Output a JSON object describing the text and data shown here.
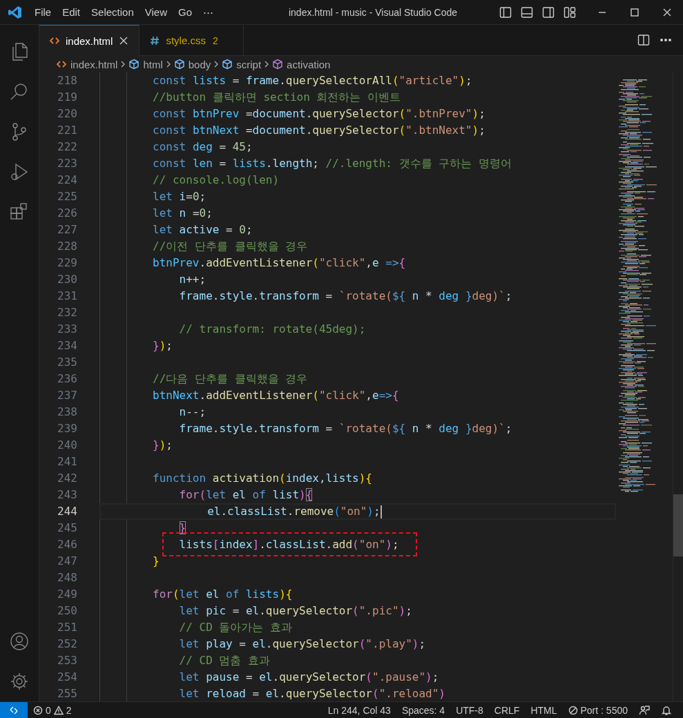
{
  "window": {
    "title": "index.html - music - Visual Studio Code"
  },
  "menu": [
    "File",
    "Edit",
    "Selection",
    "View",
    "Go",
    "⋯"
  ],
  "tabs": [
    {
      "label": "index.html",
      "kind": "html",
      "selected": true
    },
    {
      "label": "style.css",
      "kind": "css",
      "selected": false,
      "problems": "2"
    }
  ],
  "breadcrumb": [
    {
      "label": "index.html",
      "kind": "file"
    },
    {
      "label": "html",
      "kind": "element"
    },
    {
      "label": "body",
      "kind": "element"
    },
    {
      "label": "script",
      "kind": "element"
    },
    {
      "label": "activation",
      "kind": "method"
    }
  ],
  "editor": {
    "lines": [
      {
        "number": "218",
        "current": false,
        "boxed": false,
        "tokens": [
          {
            "kind": "keyword",
            "text": "        const"
          },
          {
            "kind": "constant",
            "text": " lists"
          },
          {
            "kind": "punct",
            "text": " = "
          },
          {
            "kind": "variable",
            "text": "frame"
          },
          {
            "kind": "punct",
            "text": "."
          },
          {
            "kind": "function",
            "text": "querySelectorAll"
          },
          {
            "kind": "bracket1",
            "text": "("
          },
          {
            "kind": "string",
            "text": "\"article\""
          },
          {
            "kind": "bracket1",
            "text": ")"
          },
          {
            "kind": "punct",
            "text": ";"
          }
        ]
      },
      {
        "number": "219",
        "current": false,
        "boxed": false,
        "tokens": [
          {
            "kind": "comment",
            "text": "        //button 클릭하면 section 회전하는 이벤트"
          }
        ]
      },
      {
        "number": "220",
        "current": false,
        "boxed": false,
        "tokens": [
          {
            "kind": "keyword",
            "text": "        const"
          },
          {
            "kind": "constant",
            "text": " btnPrev"
          },
          {
            "kind": "punct",
            "text": " ="
          },
          {
            "kind": "variable",
            "text": "document"
          },
          {
            "kind": "punct",
            "text": "."
          },
          {
            "kind": "function",
            "text": "querySelector"
          },
          {
            "kind": "bracket1",
            "text": "("
          },
          {
            "kind": "string",
            "text": "\".btnPrev\""
          },
          {
            "kind": "bracket1",
            "text": ")"
          },
          {
            "kind": "punct",
            "text": ";"
          }
        ]
      },
      {
        "number": "221",
        "current": false,
        "boxed": false,
        "tokens": [
          {
            "kind": "keyword",
            "text": "        const"
          },
          {
            "kind": "constant",
            "text": " btnNext"
          },
          {
            "kind": "punct",
            "text": " ="
          },
          {
            "kind": "variable",
            "text": "document"
          },
          {
            "kind": "punct",
            "text": "."
          },
          {
            "kind": "function",
            "text": "querySelector"
          },
          {
            "kind": "bracket1",
            "text": "("
          },
          {
            "kind": "string",
            "text": "\".btnNext\""
          },
          {
            "kind": "bracket1",
            "text": ")"
          },
          {
            "kind": "punct",
            "text": ";"
          }
        ]
      },
      {
        "number": "222",
        "current": false,
        "boxed": false,
        "tokens": [
          {
            "kind": "keyword",
            "text": "        const"
          },
          {
            "kind": "constant",
            "text": " deg"
          },
          {
            "kind": "punct",
            "text": " = "
          },
          {
            "kind": "number",
            "text": "45"
          },
          {
            "kind": "punct",
            "text": ";"
          }
        ]
      },
      {
        "number": "223",
        "current": false,
        "boxed": false,
        "tokens": [
          {
            "kind": "keyword",
            "text": "        const"
          },
          {
            "kind": "constant",
            "text": " len"
          },
          {
            "kind": "punct",
            "text": " = "
          },
          {
            "kind": "constant",
            "text": "lists"
          },
          {
            "kind": "punct",
            "text": "."
          },
          {
            "kind": "variable",
            "text": "length"
          },
          {
            "kind": "punct",
            "text": "; "
          },
          {
            "kind": "comment",
            "text": "//.length: 갯수를 구하는 명령어"
          }
        ]
      },
      {
        "number": "224",
        "current": false,
        "boxed": false,
        "tokens": [
          {
            "kind": "comment",
            "text": "        // console.log(len)"
          }
        ]
      },
      {
        "number": "225",
        "current": false,
        "boxed": false,
        "tokens": [
          {
            "kind": "keyword",
            "text": "        let"
          },
          {
            "kind": "variable",
            "text": " i"
          },
          {
            "kind": "punct",
            "text": "="
          },
          {
            "kind": "number",
            "text": "0"
          },
          {
            "kind": "punct",
            "text": ";"
          }
        ]
      },
      {
        "number": "226",
        "current": false,
        "boxed": false,
        "tokens": [
          {
            "kind": "keyword",
            "text": "        let"
          },
          {
            "kind": "variable",
            "text": " n"
          },
          {
            "kind": "punct",
            "text": " ="
          },
          {
            "kind": "number",
            "text": "0"
          },
          {
            "kind": "punct",
            "text": ";"
          }
        ]
      },
      {
        "number": "227",
        "current": false,
        "boxed": false,
        "tokens": [
          {
            "kind": "keyword",
            "text": "        let"
          },
          {
            "kind": "variable",
            "text": " active"
          },
          {
            "kind": "punct",
            "text": " = "
          },
          {
            "kind": "number",
            "text": "0"
          },
          {
            "kind": "punct",
            "text": ";"
          }
        ]
      },
      {
        "number": "228",
        "current": false,
        "boxed": false,
        "tokens": [
          {
            "kind": "comment",
            "text": "        //이전 단추를 클릭했을 경우"
          }
        ]
      },
      {
        "number": "229",
        "current": false,
        "boxed": false,
        "tokens": [
          {
            "kind": "constant",
            "text": "        btnPrev"
          },
          {
            "kind": "punct",
            "text": "."
          },
          {
            "kind": "function",
            "text": "addEventListener"
          },
          {
            "kind": "bracket1",
            "text": "("
          },
          {
            "kind": "string",
            "text": "\"click\""
          },
          {
            "kind": "punct",
            "text": ","
          },
          {
            "kind": "variable",
            "text": "e"
          },
          {
            "kind": "keyword",
            "text": " =>"
          },
          {
            "kind": "bracket2",
            "text": "{"
          }
        ]
      },
      {
        "number": "230",
        "current": false,
        "boxed": false,
        "tokens": [
          {
            "kind": "variable",
            "text": "            n"
          },
          {
            "kind": "punct",
            "text": "++;"
          }
        ]
      },
      {
        "number": "231",
        "current": false,
        "boxed": false,
        "tokens": [
          {
            "kind": "variable",
            "text": "            frame"
          },
          {
            "kind": "punct",
            "text": "."
          },
          {
            "kind": "variable",
            "text": "style"
          },
          {
            "kind": "punct",
            "text": "."
          },
          {
            "kind": "variable",
            "text": "transform"
          },
          {
            "kind": "punct",
            "text": " = "
          },
          {
            "kind": "string",
            "text": "`rotate("
          },
          {
            "kind": "interp",
            "text": "${"
          },
          {
            "kind": "variable",
            "text": " n"
          },
          {
            "kind": "punct",
            "text": " * "
          },
          {
            "kind": "constant",
            "text": "deg"
          },
          {
            "kind": "interp",
            "text": " }"
          },
          {
            "kind": "string",
            "text": "deg)`"
          },
          {
            "kind": "punct",
            "text": ";"
          }
        ]
      },
      {
        "number": "232",
        "current": false,
        "boxed": false
      },
      {
        "number": "233",
        "current": false,
        "boxed": false,
        "tokens": [
          {
            "kind": "comment",
            "text": "            // transform: rotate(45deg);"
          }
        ]
      },
      {
        "number": "234",
        "current": false,
        "boxed": false,
        "tokens": [
          {
            "kind": "bracket2",
            "text": "        }"
          },
          {
            "kind": "bracket1",
            "text": ")"
          },
          {
            "kind": "punct",
            "text": ";"
          }
        ]
      },
      {
        "number": "235",
        "current": false,
        "boxed": false
      },
      {
        "number": "236",
        "current": false,
        "boxed": false,
        "tokens": [
          {
            "kind": "comment",
            "text": "        //다음 단추를 클릭했을 경우"
          }
        ]
      },
      {
        "number": "237",
        "current": false,
        "boxed": false,
        "tokens": [
          {
            "kind": "constant",
            "text": "        btnNext"
          },
          {
            "kind": "punct",
            "text": "."
          },
          {
            "kind": "function",
            "text": "addEventListener"
          },
          {
            "kind": "bracket1",
            "text": "("
          },
          {
            "kind": "string",
            "text": "\"click\""
          },
          {
            "kind": "punct",
            "text": ","
          },
          {
            "kind": "variable",
            "text": "e"
          },
          {
            "kind": "keyword",
            "text": "=>"
          },
          {
            "kind": "bracket2",
            "text": "{"
          }
        ]
      },
      {
        "number": "238",
        "current": false,
        "boxed": false,
        "tokens": [
          {
            "kind": "variable",
            "text": "            n"
          },
          {
            "kind": "punct",
            "text": "--;"
          }
        ]
      },
      {
        "number": "239",
        "current": false,
        "boxed": false,
        "tokens": [
          {
            "kind": "variable",
            "text": "            frame"
          },
          {
            "kind": "punct",
            "text": "."
          },
          {
            "kind": "variable",
            "text": "style"
          },
          {
            "kind": "punct",
            "text": "."
          },
          {
            "kind": "variable",
            "text": "transform"
          },
          {
            "kind": "punct",
            "text": " = "
          },
          {
            "kind": "string",
            "text": "`rotate("
          },
          {
            "kind": "interp",
            "text": "${"
          },
          {
            "kind": "variable",
            "text": " n"
          },
          {
            "kind": "punct",
            "text": " * "
          },
          {
            "kind": "constant",
            "text": "deg"
          },
          {
            "kind": "interp",
            "text": " }"
          },
          {
            "kind": "string",
            "text": "deg)`"
          },
          {
            "kind": "punct",
            "text": ";"
          }
        ]
      },
      {
        "number": "240",
        "current": false,
        "boxed": false,
        "tokens": [
          {
            "kind": "bracket2",
            "text": "        }"
          },
          {
            "kind": "bracket1",
            "text": ")"
          },
          {
            "kind": "punct",
            "text": ";"
          }
        ]
      },
      {
        "number": "241",
        "current": false,
        "boxed": false
      },
      {
        "number": "242",
        "current": false,
        "boxed": false,
        "tokens": [
          {
            "kind": "keyword",
            "text": "        function"
          },
          {
            "kind": "function",
            "text": " activation"
          },
          {
            "kind": "bracket1",
            "text": "("
          },
          {
            "kind": "variable",
            "text": "index"
          },
          {
            "kind": "punct",
            "text": ","
          },
          {
            "kind": "variable",
            "text": "lists"
          },
          {
            "kind": "bracket1",
            "text": ")"
          },
          {
            "kind": "bracket1",
            "text": "{"
          }
        ]
      },
      {
        "number": "243",
        "current": false,
        "boxed": false,
        "tokens": [
          {
            "kind": "control",
            "text": "            for"
          },
          {
            "kind": "bracket2",
            "text": "("
          },
          {
            "kind": "keyword",
            "text": "let"
          },
          {
            "kind": "variable",
            "text": " el"
          },
          {
            "kind": "keyword",
            "text": " of"
          },
          {
            "kind": "variable",
            "text": " list"
          },
          {
            "kind": "bracket2",
            "text": ")"
          },
          {
            "kind": "bracket2",
            "text": "{",
            "matched": true
          }
        ]
      },
      {
        "number": "244",
        "current": true,
        "boxed": false,
        "tokens": [
          {
            "kind": "variable",
            "text": "                el"
          },
          {
            "kind": "punct",
            "text": "."
          },
          {
            "kind": "variable",
            "text": "classList"
          },
          {
            "kind": "punct",
            "text": "."
          },
          {
            "kind": "function",
            "text": "remove"
          },
          {
            "kind": "bracket3",
            "text": "("
          },
          {
            "kind": "string",
            "text": "\"on\""
          },
          {
            "kind": "bracket3",
            "text": ")"
          },
          {
            "kind": "punct",
            "text": ";"
          }
        ]
      },
      {
        "number": "245",
        "current": false,
        "boxed": false,
        "tokens": [
          {
            "kind": "bracket2",
            "text": "            }",
            "matched": true
          }
        ]
      },
      {
        "number": "246",
        "current": false,
        "boxed": true,
        "tokens": [
          {
            "kind": "variable",
            "text": "            lists"
          },
          {
            "kind": "bracket2",
            "text": "["
          },
          {
            "kind": "variable",
            "text": "index"
          },
          {
            "kind": "bracket2",
            "text": "]"
          },
          {
            "kind": "punct",
            "text": "."
          },
          {
            "kind": "variable",
            "text": "classList"
          },
          {
            "kind": "punct",
            "text": "."
          },
          {
            "kind": "function",
            "text": "add"
          },
          {
            "kind": "bracket2",
            "text": "("
          },
          {
            "kind": "string",
            "text": "\"on\""
          },
          {
            "kind": "bracket2",
            "text": ")"
          },
          {
            "kind": "punct",
            "text": ";"
          }
        ]
      },
      {
        "number": "247",
        "current": false,
        "boxed": false,
        "tokens": [
          {
            "kind": "bracket1",
            "text": "        }"
          }
        ]
      },
      {
        "number": "248",
        "current": false,
        "boxed": false
      },
      {
        "number": "249",
        "current": false,
        "boxed": false,
        "tokens": [
          {
            "kind": "control",
            "text": "        for"
          },
          {
            "kind": "bracket1",
            "text": "("
          },
          {
            "kind": "keyword",
            "text": "let"
          },
          {
            "kind": "variable",
            "text": " el"
          },
          {
            "kind": "keyword",
            "text": " of"
          },
          {
            "kind": "constant",
            "text": " lists"
          },
          {
            "kind": "bracket1",
            "text": ")"
          },
          {
            "kind": "bracket1",
            "text": "{"
          }
        ]
      },
      {
        "number": "250",
        "current": false,
        "boxed": false,
        "tokens": [
          {
            "kind": "keyword",
            "text": "            let"
          },
          {
            "kind": "variable",
            "text": " pic"
          },
          {
            "kind": "punct",
            "text": " = "
          },
          {
            "kind": "variable",
            "text": "el"
          },
          {
            "kind": "punct",
            "text": "."
          },
          {
            "kind": "function",
            "text": "querySelector"
          },
          {
            "kind": "bracket2",
            "text": "("
          },
          {
            "kind": "string",
            "text": "\".pic\""
          },
          {
            "kind": "bracket2",
            "text": ")"
          },
          {
            "kind": "punct",
            "text": ";"
          }
        ]
      },
      {
        "number": "251",
        "current": false,
        "boxed": false,
        "tokens": [
          {
            "kind": "comment",
            "text": "            // CD 돌아가는 효과"
          }
        ]
      },
      {
        "number": "252",
        "current": false,
        "boxed": false,
        "tokens": [
          {
            "kind": "keyword",
            "text": "            let"
          },
          {
            "kind": "variable",
            "text": " play"
          },
          {
            "kind": "punct",
            "text": " = "
          },
          {
            "kind": "variable",
            "text": "el"
          },
          {
            "kind": "punct",
            "text": "."
          },
          {
            "kind": "function",
            "text": "querySelector"
          },
          {
            "kind": "bracket2",
            "text": "("
          },
          {
            "kind": "string",
            "text": "\".play\""
          },
          {
            "kind": "bracket2",
            "text": ")"
          },
          {
            "kind": "punct",
            "text": ";"
          }
        ]
      },
      {
        "number": "253",
        "current": false,
        "boxed": false,
        "tokens": [
          {
            "kind": "comment",
            "text": "            // CD 멈춤 효과"
          }
        ]
      },
      {
        "number": "254",
        "current": false,
        "boxed": false,
        "tokens": [
          {
            "kind": "keyword",
            "text": "            let"
          },
          {
            "kind": "variable",
            "text": " pause"
          },
          {
            "kind": "punct",
            "text": " = "
          },
          {
            "kind": "variable",
            "text": "el"
          },
          {
            "kind": "punct",
            "text": "."
          },
          {
            "kind": "function",
            "text": "querySelector"
          },
          {
            "kind": "bracket2",
            "text": "("
          },
          {
            "kind": "string",
            "text": "\".pause\""
          },
          {
            "kind": "bracket2",
            "text": ")"
          },
          {
            "kind": "punct",
            "text": ";"
          }
        ]
      },
      {
        "number": "255",
        "current": false,
        "boxed": false,
        "tokens": [
          {
            "kind": "keyword",
            "text": "            let"
          },
          {
            "kind": "variable",
            "text": " reload"
          },
          {
            "kind": "punct",
            "text": " = "
          },
          {
            "kind": "variable",
            "text": "el"
          },
          {
            "kind": "punct",
            "text": "."
          },
          {
            "kind": "function",
            "text": "querySelector"
          },
          {
            "kind": "bracket2",
            "text": "("
          },
          {
            "kind": "string",
            "text": "\".reload\""
          },
          {
            "kind": "bracket2",
            "text": ")"
          }
        ]
      }
    ]
  },
  "status_bar": {
    "errors": "0",
    "warnings": "2",
    "position": "Ln 244, Col 43",
    "spaces": "Spaces: 4",
    "encoding": "UTF-8",
    "eol": "CRLF",
    "language": "HTML",
    "port": "Port : 5500"
  }
}
